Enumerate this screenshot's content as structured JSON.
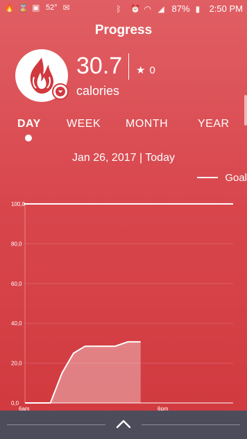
{
  "status_bar": {
    "battery": "87%",
    "time": "2:50 PM",
    "temperature": "52°",
    "left_icons": [
      "fire-icon",
      "hourglass-icon",
      "image-icon",
      "weather-icon",
      "mail-icon"
    ],
    "right_icons": [
      "bluetooth-icon",
      "alarm-icon",
      "wifi-icon",
      "signal-icon",
      "battery-icon"
    ]
  },
  "header": {
    "title": "Progress"
  },
  "summary": {
    "value": "30.7",
    "unit": "calories",
    "stars": "0"
  },
  "tabs": [
    {
      "label": "DAY",
      "active": true
    },
    {
      "label": "WEEK",
      "active": false
    },
    {
      "label": "MONTH",
      "active": false
    },
    {
      "label": "YEAR",
      "active": false
    }
  ],
  "date_label": "Jan 26, 2017 | Today",
  "legend": {
    "goal_label": "Goal"
  },
  "chart_data": {
    "type": "area",
    "title": "",
    "xlabel": "",
    "ylabel": "",
    "ylim": [
      0,
      100
    ],
    "yticks": [
      "0,0",
      "20,0",
      "40,0",
      "60,0",
      "80,0",
      "100,0"
    ],
    "xticks": [
      {
        "label": "6am",
        "hour": 6
      },
      {
        "label": "6pm",
        "hour": 18
      }
    ],
    "goal": 100,
    "series": [
      {
        "points": [
          {
            "hour": 6.0,
            "value": 0
          },
          {
            "hour": 8.2,
            "value": 0
          },
          {
            "hour": 9.2,
            "value": 15
          },
          {
            "hour": 10.2,
            "value": 25
          },
          {
            "hour": 11.2,
            "value": 28.5
          },
          {
            "hour": 13.8,
            "value": 28.5
          },
          {
            "hour": 14.9,
            "value": 30.7
          },
          {
            "hour": 16.0,
            "value": 30.7
          }
        ]
      }
    ]
  }
}
